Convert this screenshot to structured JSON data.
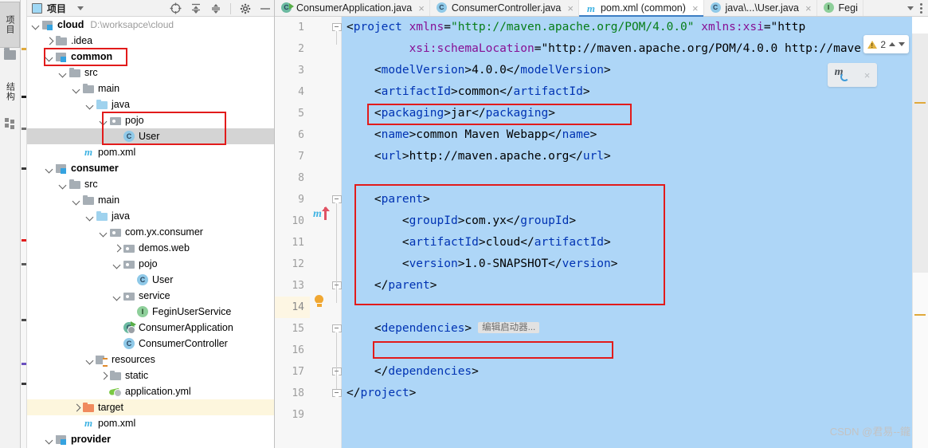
{
  "ide": {
    "left_strip": {
      "project_tab": "项目",
      "structure_tab": "结构"
    },
    "project_panel": {
      "title": "项目",
      "toolbar": [
        {
          "name": "select-opened-file-icon",
          "label": "Select Opened File"
        },
        {
          "name": "expand-all-icon",
          "label": "Expand All"
        },
        {
          "name": "collapse-all-icon",
          "label": "Collapse All"
        },
        {
          "name": "settings-gear-icon",
          "label": "Settings"
        },
        {
          "name": "hide-panel-icon",
          "label": "Hide"
        }
      ],
      "tree": [
        {
          "label": "cloud",
          "path": "D:\\worksapce\\cloud",
          "indent": 0,
          "arrow": "down",
          "icon": "mod",
          "bold": true
        },
        {
          "label": ".idea",
          "path": "",
          "indent": 1,
          "arrow": "right",
          "icon": "folder-grey",
          "bold": false
        },
        {
          "label": "common",
          "path": "",
          "indent": 1,
          "arrow": "down",
          "icon": "mod",
          "bold": true
        },
        {
          "label": "src",
          "path": "",
          "indent": 2,
          "arrow": "down",
          "icon": "folder-grey",
          "bold": false
        },
        {
          "label": "main",
          "path": "",
          "indent": 3,
          "arrow": "down",
          "icon": "folder-grey",
          "bold": false
        },
        {
          "label": "java",
          "path": "",
          "indent": 4,
          "arrow": "down",
          "icon": "folder-blue",
          "bold": false
        },
        {
          "label": "pojo",
          "path": "",
          "indent": 5,
          "arrow": "down",
          "icon": "pkg",
          "bold": false
        },
        {
          "label": "User",
          "path": "",
          "indent": 6,
          "arrow": "none",
          "icon": "cls",
          "bold": false,
          "selected": true
        },
        {
          "label": "pom.xml",
          "path": "",
          "indent": 3,
          "arrow": "none",
          "icon": "mvn",
          "bold": false
        },
        {
          "label": "consumer",
          "path": "",
          "indent": 1,
          "arrow": "down",
          "icon": "mod",
          "bold": true
        },
        {
          "label": "src",
          "path": "",
          "indent": 2,
          "arrow": "down",
          "icon": "folder-grey",
          "bold": false
        },
        {
          "label": "main",
          "path": "",
          "indent": 3,
          "arrow": "down",
          "icon": "folder-grey",
          "bold": false
        },
        {
          "label": "java",
          "path": "",
          "indent": 4,
          "arrow": "down",
          "icon": "folder-blue",
          "bold": false
        },
        {
          "label": "com.yx.consumer",
          "path": "",
          "indent": 5,
          "arrow": "down",
          "icon": "pkg",
          "bold": false
        },
        {
          "label": "demos.web",
          "path": "",
          "indent": 6,
          "arrow": "right",
          "icon": "pkg",
          "bold": false
        },
        {
          "label": "pojo",
          "path": "",
          "indent": 6,
          "arrow": "down",
          "icon": "pkg",
          "bold": false
        },
        {
          "label": "User",
          "path": "",
          "indent": 7,
          "arrow": "none",
          "icon": "cls",
          "bold": false
        },
        {
          "label": "service",
          "path": "",
          "indent": 6,
          "arrow": "down",
          "icon": "pkg",
          "bold": false
        },
        {
          "label": "FeginUserService",
          "path": "",
          "indent": 7,
          "arrow": "none",
          "icon": "iface",
          "bold": false
        },
        {
          "label": "ConsumerApplication",
          "path": "",
          "indent": 6,
          "arrow": "none",
          "icon": "cls-run",
          "bold": false
        },
        {
          "label": "ConsumerController",
          "path": "",
          "indent": 6,
          "arrow": "none",
          "icon": "cls",
          "bold": false
        },
        {
          "label": "resources",
          "path": "",
          "indent": 4,
          "arrow": "down",
          "icon": "res",
          "bold": false
        },
        {
          "label": "static",
          "path": "",
          "indent": 5,
          "arrow": "right",
          "icon": "folder-grey",
          "bold": false
        },
        {
          "label": "application.yml",
          "path": "",
          "indent": 5,
          "arrow": "none",
          "icon": "yml",
          "bold": false
        },
        {
          "label": "target",
          "path": "",
          "indent": 3,
          "arrow": "right",
          "icon": "folder-orange",
          "bold": false,
          "highlight": true
        },
        {
          "label": "pom.xml",
          "path": "",
          "indent": 3,
          "arrow": "none",
          "icon": "mvn",
          "bold": false
        },
        {
          "label": "provider",
          "path": "",
          "indent": 1,
          "arrow": "down",
          "icon": "mod",
          "bold": true
        }
      ]
    },
    "editor_tabs": [
      {
        "label": "ConsumerApplication.java",
        "icon": "class-run-icon",
        "active": false,
        "closable": true
      },
      {
        "label": "ConsumerController.java",
        "icon": "class-icon",
        "active": false,
        "closable": true
      },
      {
        "label": "pom.xml (common)",
        "icon": "maven-icon",
        "active": true,
        "closable": true
      },
      {
        "label": "java\\...\\User.java",
        "icon": "class-icon",
        "active": false,
        "closable": true
      },
      {
        "label": "Fegi",
        "icon": "interface-icon",
        "active": false,
        "closable": false
      }
    ],
    "editor": {
      "filename": "pom.xml",
      "warning_count": "2",
      "inline_hint": "编辑启动器...",
      "current_line": 14,
      "lines": [
        {
          "no": "1",
          "text": "<project xmlns=\"http://maven.apache.org/POM/4.0.0\" xmlns:xsi=\"http",
          "fold": "start"
        },
        {
          "no": "2",
          "text": "         xsi:schemaLocation=\"http://maven.apache.org/POM/4.0.0 http://mave",
          "fold": "none"
        },
        {
          "no": "3",
          "text": "    <modelVersion>4.0.0</modelVersion>",
          "fold": "none"
        },
        {
          "no": "4",
          "text": "    <artifactId>common</artifactId>",
          "fold": "none"
        },
        {
          "no": "5",
          "text": "    <packaging>jar</packaging>",
          "fold": "none"
        },
        {
          "no": "6",
          "text": "    <name>common Maven Webapp</name>",
          "fold": "none"
        },
        {
          "no": "7",
          "text": "    <url>http://maven.apache.org</url>",
          "fold": "none"
        },
        {
          "no": "8",
          "text": "",
          "fold": "none"
        },
        {
          "no": "9",
          "text": "    <parent>",
          "fold": "start"
        },
        {
          "no": "10",
          "text": "        <groupId>com.yx</groupId>",
          "fold": "none"
        },
        {
          "no": "11",
          "text": "        <artifactId>cloud</artifactId>",
          "fold": "none"
        },
        {
          "no": "12",
          "text": "        <version>1.0-SNAPSHOT</version>",
          "fold": "none"
        },
        {
          "no": "13",
          "text": "    </parent>",
          "fold": "end"
        },
        {
          "no": "14",
          "text": "",
          "fold": "none"
        },
        {
          "no": "15",
          "text": "    <dependencies>",
          "fold": "start"
        },
        {
          "no": "16",
          "text": "",
          "fold": "none"
        },
        {
          "no": "17",
          "text": "    </dependencies>",
          "fold": "end"
        },
        {
          "no": "18",
          "text": "</project>",
          "fold": "end"
        },
        {
          "no": "19",
          "text": "",
          "fold": "none"
        }
      ]
    },
    "maven_popup": {
      "reload_label": "m",
      "close_label": "×"
    },
    "watermark": "CSDN @君易--鑨",
    "colors": {
      "selection": "#aed6f7",
      "annotation_red": "#e21b1b",
      "tab_active_underline": "#3d7ec4",
      "tag_blue": "#0033b3",
      "string_green": "#067d17",
      "ns_purple": "#871094"
    }
  }
}
